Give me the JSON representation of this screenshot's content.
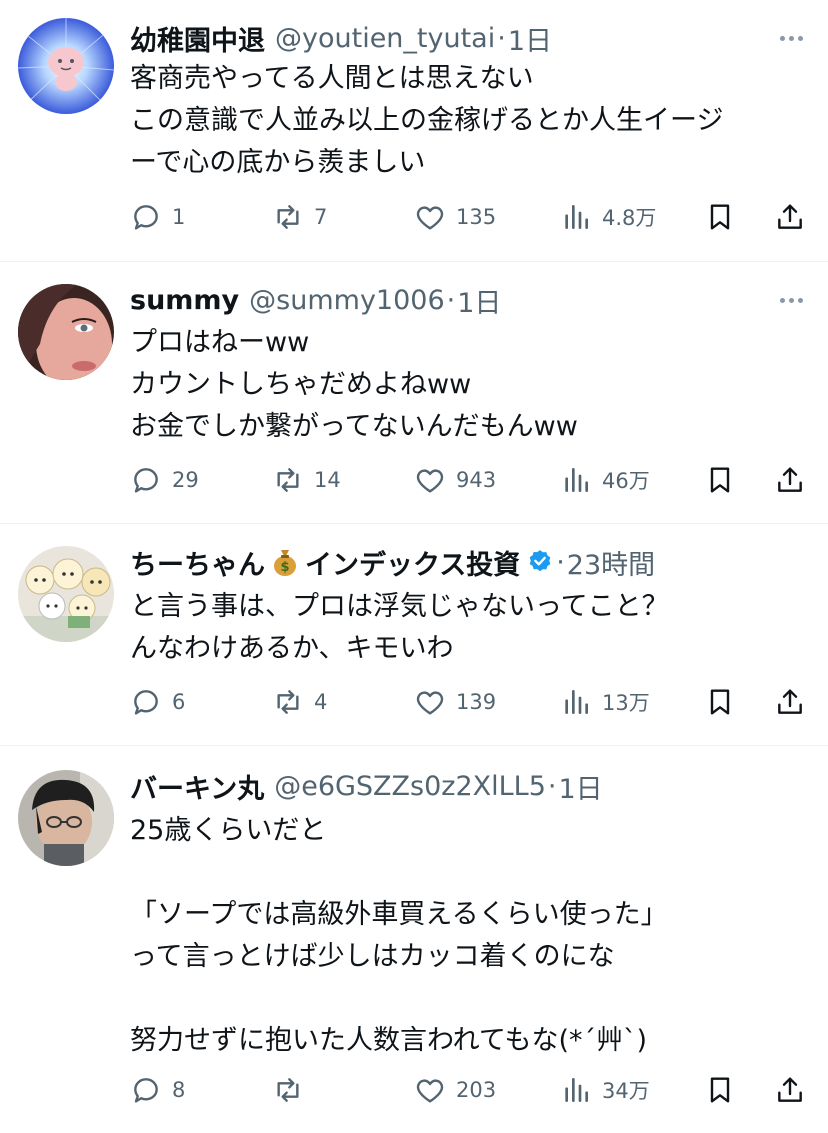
{
  "tweets": [
    {
      "name": "幼稚園中退",
      "handle": "@youtien_tyutai",
      "time": "1日",
      "lines": [
        "客商売やってる人間とは思えない",
        "この意識で人並み以上の金稼げるとか人生イージ",
        "ーで心の底から羨ましい"
      ],
      "replies": "1",
      "reposts": "7",
      "likes": "135",
      "views": "4.8万"
    },
    {
      "name": "summy",
      "handle": "@summy1006",
      "time": "1日",
      "lines": [
        "プロはねーww",
        "カウントしちゃだめよねww",
        "お金でしか繋がってないんだもんww"
      ],
      "replies": "29",
      "reposts": "14",
      "likes": "943",
      "views": "46万"
    },
    {
      "name": "ちーちゃん",
      "name_emoji": "money-bag-emoji",
      "name_suffix": "インデックス投資",
      "verified": true,
      "time": "23時間",
      "lines": [
        "と言う事は、プロは浮気じゃないってこと？",
        "んなわけあるか、キモいわ"
      ],
      "replies": "6",
      "reposts": "4",
      "likes": "139",
      "views": "13万"
    },
    {
      "name": "バーキン丸",
      "handle": "@e6GSZZs0z2XlLL5",
      "time": "1日",
      "lines": [
        "25歳くらいだと",
        "",
        "「ソープでは高級外車買えるくらい使った」",
        "って言っとけば少しはカッコ着くのにな",
        "",
        "努力せずに抱いた人数言われてもな(*´艸`)"
      ],
      "replies": "8",
      "reposts": "",
      "likes": "203",
      "views": "34万"
    }
  ],
  "icons": {
    "reply": "reply-icon",
    "repost": "repost-icon",
    "like": "heart-icon",
    "views": "views-icon",
    "bookmark": "bookmark-icon",
    "share": "share-icon",
    "more": "more-icon"
  },
  "colors": {
    "text": "#0f1419",
    "secondary": "#536471",
    "verified": "#1d9bf0",
    "divider": "#eff3f4"
  }
}
